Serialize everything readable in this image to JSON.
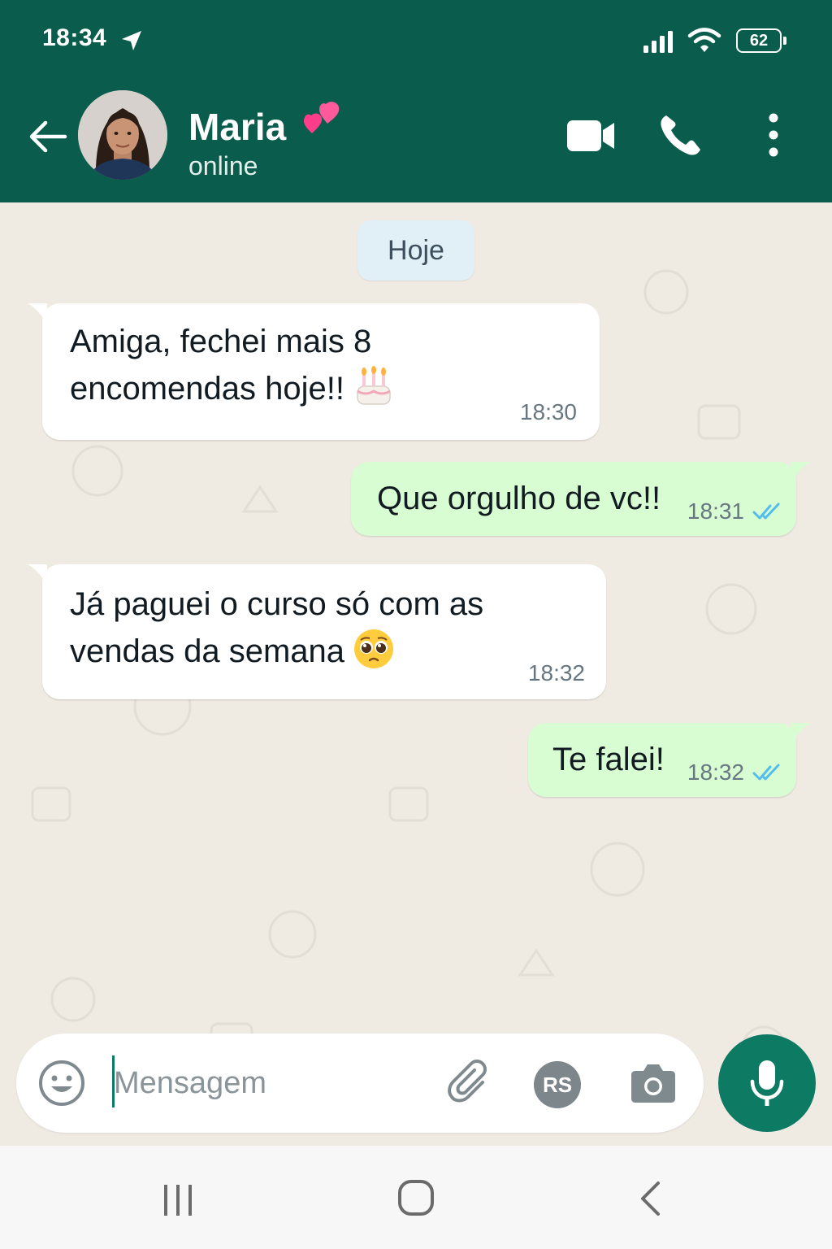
{
  "status_bar": {
    "time": "18:34",
    "battery": "62"
  },
  "header": {
    "contact_name": "Maria",
    "name_emoji": "two-hearts-emoji",
    "status": "online",
    "icons": [
      "back-arrow-icon",
      "video-camera-icon",
      "phone-icon",
      "more-vertical-icon"
    ]
  },
  "chat": {
    "date_chip": "Hoje",
    "messages": [
      {
        "direction": "in",
        "text": "Amiga, fechei mais 8\nencomendas hoje!!",
        "emoji": "birthday-cake-emoji",
        "time": "18:30"
      },
      {
        "direction": "out",
        "text": "Que orgulho de vc!!",
        "time": "18:31",
        "status": "read"
      },
      {
        "direction": "in",
        "text": "Já paguei o curso só com as\nvendas da semana",
        "emoji": "pleading-face-emoji",
        "time": "18:32"
      },
      {
        "direction": "out",
        "text": "Te falei!",
        "time": "18:32",
        "status": "read"
      }
    ]
  },
  "input": {
    "placeholder": "Mensagem",
    "value": "",
    "avatar_initials": "RS"
  },
  "colors": {
    "header": "#0a5c4d",
    "chat_bg": "#efeae2",
    "incoming": "#ffffff",
    "outgoing": "#d9fdd3",
    "mic": "#0d7a63",
    "read_ticks": "#53bdeb"
  }
}
